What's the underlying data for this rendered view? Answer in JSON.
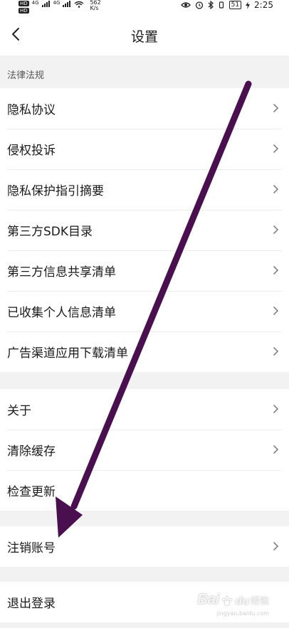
{
  "status_bar": {
    "hd1": "HD",
    "hd2": "HD",
    "net_4g_1": "4G",
    "net_4g_2": "4G",
    "speed_value": "562",
    "speed_unit": "K/s",
    "battery": "51",
    "time": "2:25"
  },
  "header": {
    "title": "设置"
  },
  "section": {
    "label": "法律法规"
  },
  "legal_items": [
    {
      "label": "隐私协议"
    },
    {
      "label": "侵权投诉"
    },
    {
      "label": "隐私保护指引摘要"
    },
    {
      "label": "第三方SDK目录"
    },
    {
      "label": "第三方信息共享清单"
    },
    {
      "label": "已收集个人信息清单"
    },
    {
      "label": "广告渠道应用下载清单"
    }
  ],
  "general_items": [
    {
      "label": "关于"
    },
    {
      "label": "清除缓存"
    },
    {
      "label": "检查更新"
    }
  ],
  "account": {
    "cancel_label": "注销账号",
    "logout_label": "退出登录"
  },
  "annotation": {
    "arrow_color": "#4a0f4e"
  },
  "watermark": {
    "brand": "Bai",
    "brand_suffix": "du",
    "text": "经验",
    "url": "jingyan.baidu.com"
  }
}
